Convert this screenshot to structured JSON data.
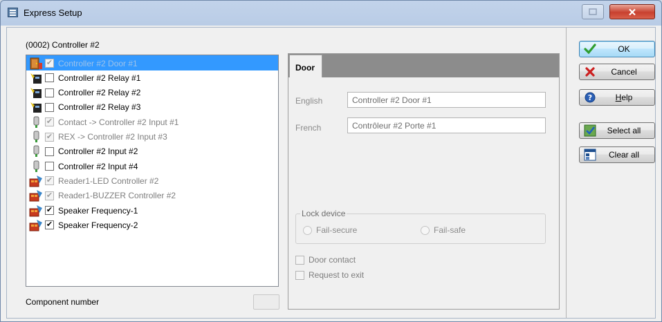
{
  "window": {
    "title": "Express Setup"
  },
  "controller_caption": "(0002) Controller #2",
  "tree": [
    {
      "icon": "door-icon",
      "label": "Controller #2 Door #1",
      "checked": true,
      "disabled": true,
      "selected": true
    },
    {
      "icon": "relay-icon",
      "label": "Controller #2 Relay #1",
      "checked": false,
      "disabled": false
    },
    {
      "icon": "relay-icon",
      "label": "Controller #2 Relay #2",
      "checked": false,
      "disabled": false
    },
    {
      "icon": "relay-icon",
      "label": "Controller #2 Relay #3",
      "checked": false,
      "disabled": false
    },
    {
      "icon": "input-icon",
      "label": "Contact -> Controller #2 Input #1",
      "checked": true,
      "disabled": true
    },
    {
      "icon": "input-icon",
      "label": "REX -> Controller #2 Input #3",
      "checked": true,
      "disabled": true
    },
    {
      "icon": "input-icon",
      "label": "Controller #2 Input #2",
      "checked": false,
      "disabled": false
    },
    {
      "icon": "input-icon",
      "label": "Controller #2 Input #4",
      "checked": false,
      "disabled": false
    },
    {
      "icon": "reader-output-icon",
      "label": "Reader1-LED Controller #2",
      "checked": true,
      "disabled": true
    },
    {
      "icon": "reader-output-icon",
      "label": "Reader1-BUZZER Controller #2",
      "checked": true,
      "disabled": true
    },
    {
      "icon": "reader-output-icon",
      "label": "Speaker Frequency-1",
      "checked": true,
      "disabled": false
    },
    {
      "icon": "reader-output-icon",
      "label": "Speaker Frequency-2",
      "checked": true,
      "disabled": false
    }
  ],
  "component_number": {
    "label": "Component number",
    "value": ""
  },
  "door_tab": {
    "tab_label": "Door",
    "english_label": "English",
    "english_value": "Controller #2 Door #1",
    "french_label": "French",
    "french_value": "Contrôleur #2 Porte #1",
    "lock_device_label": "Lock device",
    "fail_secure_label": "Fail-secure",
    "fail_safe_label": "Fail-safe",
    "door_contact_label": "Door contact",
    "request_to_exit_label": "Request to exit"
  },
  "buttons": {
    "ok": "OK",
    "cancel": "Cancel",
    "help": "Help",
    "select_all": "Select all",
    "clear_all": "Clear all"
  },
  "colors": {
    "selection": "#3399ff",
    "tab_strip": "#8c8c8c",
    "ok_check": "#2f9e2f",
    "cancel_x": "#cc1f1f"
  }
}
